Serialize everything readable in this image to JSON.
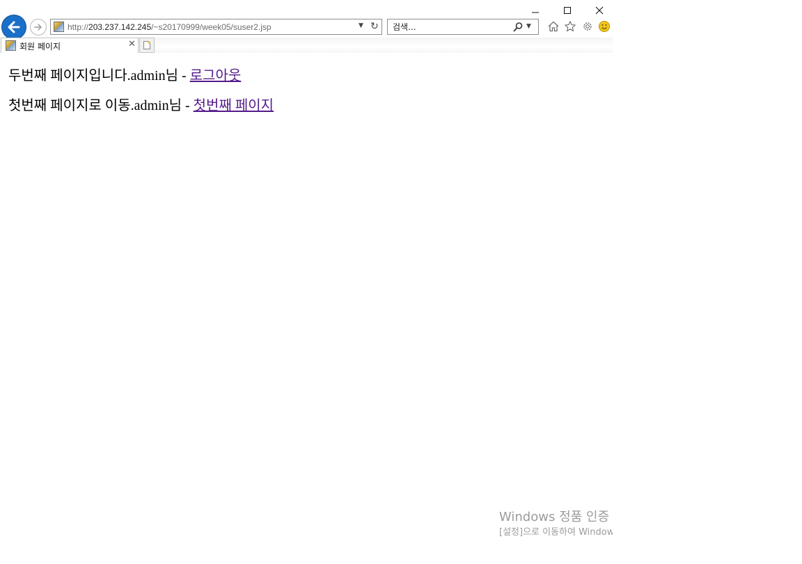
{
  "window": {
    "controls": {
      "minimize_icon": "minimize-icon",
      "maximize_icon": "maximize-icon",
      "close_icon": "close-icon"
    }
  },
  "navbar": {
    "back_icon": "back-arrow-icon",
    "forward_icon": "forward-arrow-icon",
    "address": {
      "scheme": "http://",
      "host": "203.237.142.245",
      "path": "/~s20170999/week05/suser2.jsp"
    },
    "search": {
      "placeholder": "검색..."
    },
    "toolbar_icons": [
      "home-icon",
      "star-icon",
      "gear-icon",
      "smiley-icon"
    ]
  },
  "tabs": [
    {
      "title": "회원 페이지",
      "active": true
    }
  ],
  "content": {
    "line1": {
      "text": "두번째 페이지입니다.admin님 - ",
      "link": "로그아웃"
    },
    "line2": {
      "text": "첫번째 페이지로 이동.admin님 - ",
      "link": "첫번째 페이지"
    },
    "link_color": "#551a8b"
  },
  "watermark": {
    "line1": "Windows 정품 인증",
    "line2": "[설정]으로 이동하여 Windows"
  }
}
